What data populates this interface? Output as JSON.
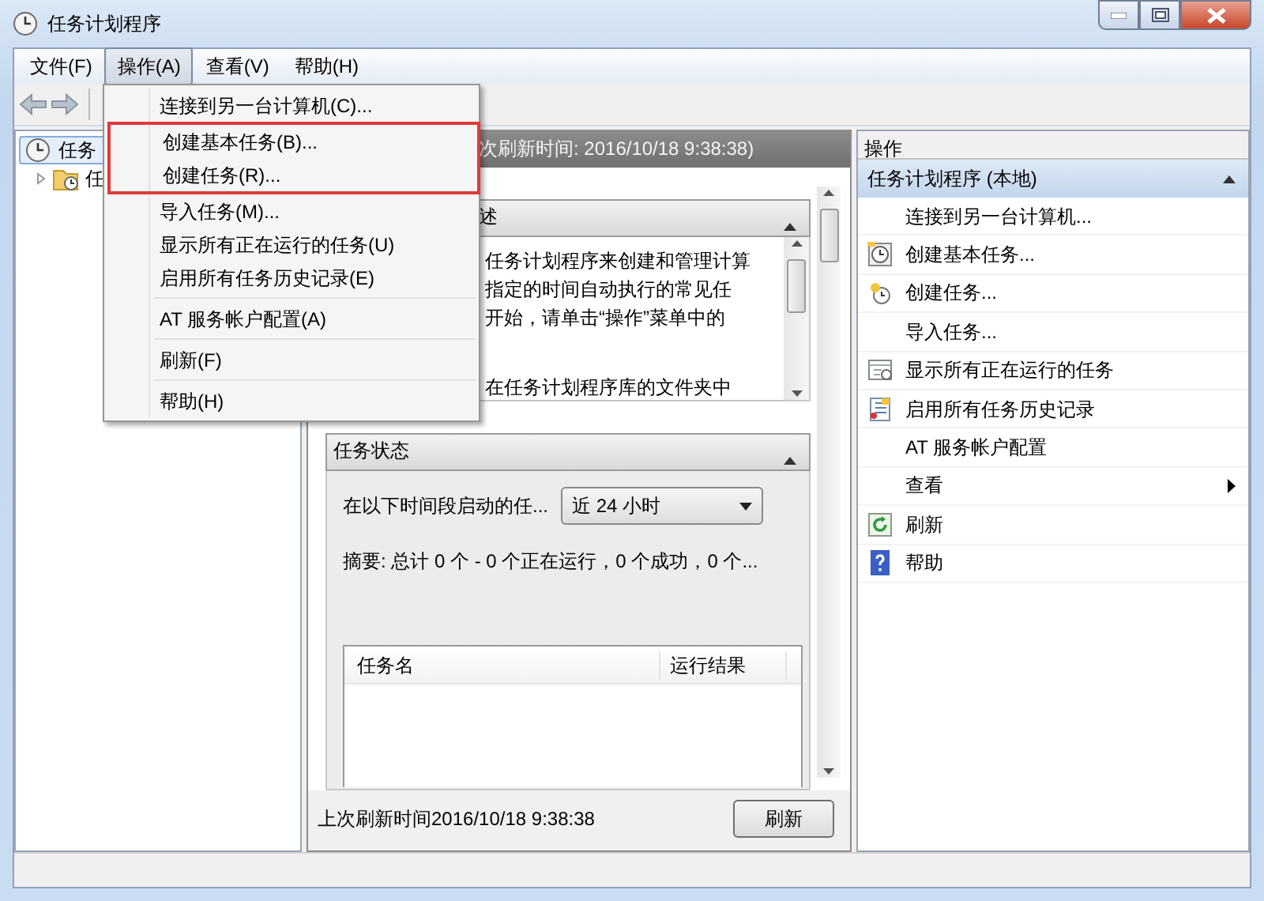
{
  "window": {
    "title": "任务计划程序"
  },
  "menu_bar": [
    {
      "label": "文件(F)",
      "selected": false
    },
    {
      "label": "操作(A)",
      "selected": true
    },
    {
      "label": "查看(V)",
      "selected": false
    },
    {
      "label": "帮助(H)",
      "selected": false
    }
  ],
  "dropdown": {
    "items": [
      {
        "kind": "item",
        "label": "连接到另一台计算机(C)...",
        "boxed": false
      },
      {
        "kind": "item",
        "label": "创建基本任务(B)...",
        "boxed": true
      },
      {
        "kind": "item",
        "label": "创建任务(R)...",
        "boxed": true
      },
      {
        "kind": "item",
        "label": "导入任务(M)...",
        "boxed": false
      },
      {
        "kind": "item",
        "label": "显示所有正在运行的任务(U)",
        "boxed": false
      },
      {
        "kind": "item",
        "label": "启用所有任务历史记录(E)",
        "boxed": false
      },
      {
        "kind": "separator"
      },
      {
        "kind": "item",
        "label": "AT 服务帐户配置(A)",
        "boxed": false
      },
      {
        "kind": "separator"
      },
      {
        "kind": "item",
        "label": "刷新(F)",
        "boxed": false
      },
      {
        "kind": "separator"
      },
      {
        "kind": "item",
        "label": "帮助(H)",
        "boxed": false
      }
    ]
  },
  "tree": [
    {
      "label": "任务",
      "selected": true,
      "children": [
        {
          "label": "任",
          "selected": false,
          "expanded": false
        }
      ]
    }
  ],
  "center": {
    "header": "次刷新时间: 2016/10/18 9:38:38)",
    "sections": [
      {
        "kind": "text",
        "title": "述",
        "expanded": true,
        "lines": [
          "任务计划程序来创建和管理计算",
          "指定的时间自动执行的常见任",
          "开始，请单击“操作”菜单中的",
          "在任务计划程序库的文件夹中"
        ]
      },
      {
        "kind": "status",
        "title": "任务状态",
        "expanded": true,
        "filter_label": "在以下时间段启动的任...",
        "filter_value": "近 24 小时",
        "summary": "摘要: 总计 0 个 - 0 个正在运行，0 个成功，0 个...",
        "columns": [
          "任务名",
          "运行结果"
        ]
      }
    ],
    "footer": {
      "text": "上次刷新时间2016/10/18 9:38:38",
      "button": "刷新"
    }
  },
  "actions": {
    "title": "操作",
    "section": {
      "title": "任务计划程序 (本地)",
      "expanded": true
    },
    "items": [
      {
        "label": "连接到另一台计算机...",
        "kind": "plain",
        "submenu": false
      },
      {
        "label": "创建基本任务...",
        "kind": "basic-task",
        "submenu": false
      },
      {
        "label": "创建任务...",
        "kind": "task",
        "submenu": false
      },
      {
        "label": "导入任务...",
        "kind": "plain",
        "submenu": false
      },
      {
        "label": "显示所有正在运行的任务",
        "kind": "running",
        "submenu": false
      },
      {
        "label": "启用所有任务历史记录",
        "kind": "history",
        "submenu": false
      },
      {
        "label": "AT 服务帐户配置",
        "kind": "plain",
        "submenu": false
      },
      {
        "label": "查看",
        "kind": "plain",
        "submenu": true
      },
      {
        "label": "刷新",
        "kind": "refresh",
        "submenu": false
      },
      {
        "label": "帮助",
        "kind": "help",
        "submenu": false
      }
    ]
  }
}
